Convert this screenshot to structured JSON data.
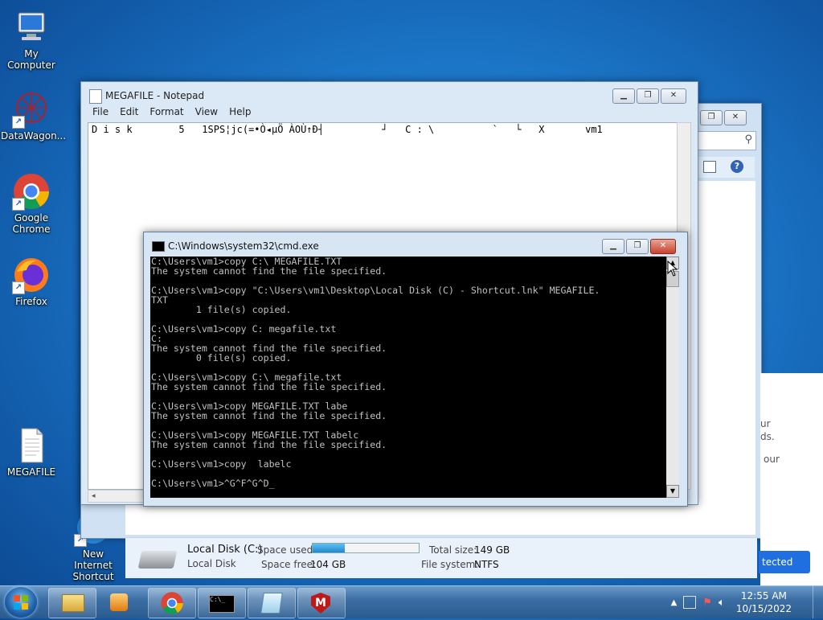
{
  "desktop_icons": [
    {
      "label": "My Computer"
    },
    {
      "label": "DataWagon..."
    },
    {
      "label": "Google Chrome"
    },
    {
      "label": "Firefox"
    },
    {
      "label": "MEGAFILE"
    },
    {
      "label": "New Internet Shortcut"
    }
  ],
  "notepad": {
    "title": "MEGAFILE - Notepad",
    "menu": [
      "File",
      "Edit",
      "Format",
      "View",
      "Help"
    ],
    "content": "D i s k        5   1SPS¦jc(=•Ò◂µÖ ÀOÙ↑Ð┤          ┘   C : \\          `   └   X       vm1"
  },
  "cmd": {
    "title": "C:\\Windows\\system32\\cmd.exe",
    "lines": [
      "C:\\Users\\vm1>copy C:\\ MEGAFILE.TXT",
      "The system cannot find the file specified.",
      "",
      "C:\\Users\\vm1>copy \"C:\\Users\\vm1\\Desktop\\Local Disk (C) - Shortcut.lnk\" MEGAFILE.",
      "TXT",
      "        1 file(s) copied.",
      "",
      "C:\\Users\\vm1>copy C: megafile.txt",
      "C:",
      "The system cannot find the file specified.",
      "        0 file(s) copied.",
      "",
      "C:\\Users\\vm1>copy C:\\ megafile.txt",
      "The system cannot find the file specified.",
      "",
      "C:\\Users\\vm1>copy MEGAFILE.TXT labe",
      "The system cannot find the file specified.",
      "",
      "C:\\Users\\vm1>copy MEGAFILE.TXT labelc",
      "The system cannot find the file specified.",
      "",
      "C:\\Users\\vm1>copy  labelc",
      "",
      "C:\\Users\\vm1>^G^F^G^D_"
    ]
  },
  "explorer": {
    "drive_name": "Local Disk (C:)",
    "drive_type": "Local Disk",
    "space_used_label": "Space used:",
    "space_free_label": "Space free:",
    "space_free_value": "104 GB",
    "total_size_label": "Total size:",
    "total_size_value": "149 GB",
    "filesystem_label": "File system:",
    "filesystem_value": "NTFS",
    "usage_fraction": 0.3
  },
  "right_panel": {
    "text_lines": [
      "ur",
      "ds.",
      "our"
    ],
    "button_fragment": "tected"
  },
  "taskbar": {
    "time": "12:55 AM",
    "date": "10/15/2022"
  }
}
